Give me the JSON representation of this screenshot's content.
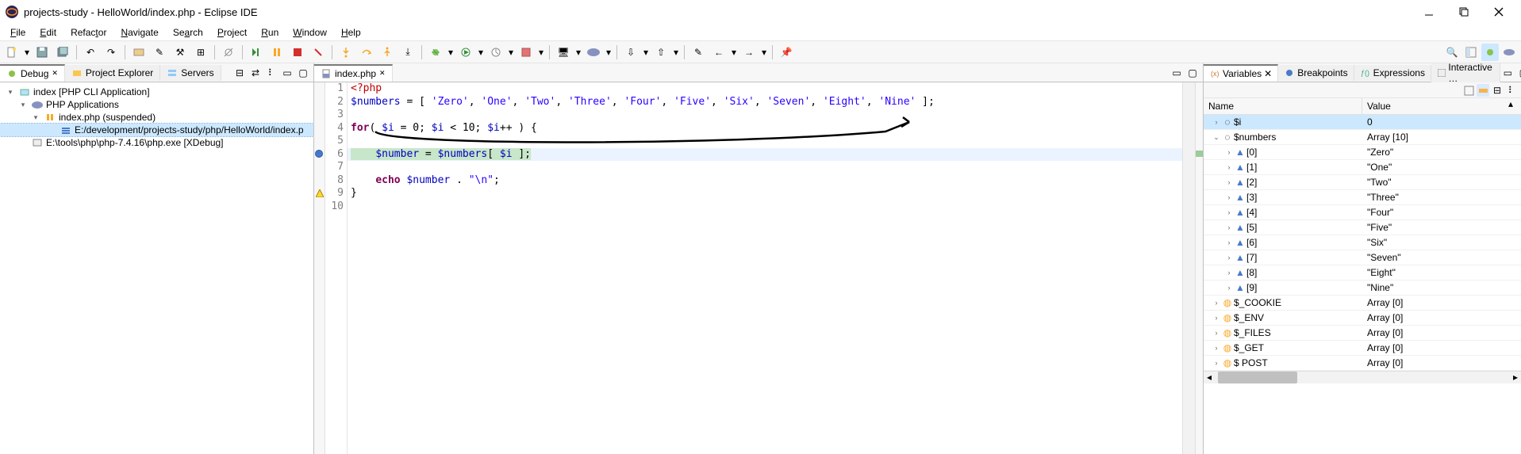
{
  "title": "projects-study - HelloWorld/index.php - Eclipse IDE",
  "menu": [
    "File",
    "Edit",
    "Refactor",
    "Navigate",
    "Search",
    "Project",
    "Run",
    "Window",
    "Help"
  ],
  "left_views": {
    "debug": "Debug",
    "project_explorer": "Project Explorer",
    "servers": "Servers"
  },
  "debug_tree": {
    "root": "index [PHP CLI Application]",
    "app": "PHP Applications",
    "thread": "index.php (suspended)",
    "frame": "E:/development/projects-study/php/HelloWorld/index.p",
    "exe": "E:\\tools\\php\\php-7.4.16\\php.exe [XDebug]"
  },
  "editor": {
    "tab": "index.php",
    "lines": [
      "1",
      "2",
      "3",
      "4",
      "5",
      "6",
      "7",
      "8",
      "9",
      "10"
    ],
    "code": {
      "l1_tag": "<?php",
      "l2_var": "$numbers",
      "l2_a": " = [ ",
      "l2_s0": "'Zero'",
      "l2_s1": "'One'",
      "l2_s2": "'Two'",
      "l2_s3": "'Three'",
      "l2_s4": "'Four'",
      "l2_s5": "'Five'",
      "l2_s6": "'Six'",
      "l2_s7": "'Seven'",
      "l2_s8": "'Eight'",
      "l2_s9": "'Nine'",
      "l2_b": " ];",
      "l4_kw": "for",
      "l4_a": "( ",
      "l4_v1": "$i",
      "l4_b": " = 0; ",
      "l4_v2": "$i",
      "l4_c": " < 10; ",
      "l4_v3": "$i",
      "l4_d": "++ ) {",
      "l6_pad": "    ",
      "l6_v1": "$number",
      "l6_a": " = ",
      "l6_v2": "$numbers",
      "l6_b": "[ ",
      "l6_v3": "$i",
      "l6_c": " ];",
      "l8_pad": "    ",
      "l8_kw": "echo",
      "l8_sp": " ",
      "l8_v": "$number",
      "l8_a": " . ",
      "l8_s": "\"\\n\"",
      "l8_b": ";",
      "l9": "}"
    }
  },
  "right_views": {
    "variables": "Variables",
    "breakpoints": "Breakpoints",
    "expressions": "Expressions",
    "interactive": "Interactive …"
  },
  "vars_header": {
    "name": "Name",
    "value": "Value"
  },
  "vars": {
    "i_name": "$i",
    "i_val": "0",
    "num_name": "$numbers",
    "num_val": "Array [10]",
    "idx": [
      "[0]",
      "[1]",
      "[2]",
      "[3]",
      "[4]",
      "[5]",
      "[6]",
      "[7]",
      "[8]",
      "[9]"
    ],
    "vals": [
      "\"Zero\"",
      "\"One\"",
      "\"Two\"",
      "\"Three\"",
      "\"Four\"",
      "\"Five\"",
      "\"Six\"",
      "\"Seven\"",
      "\"Eight\"",
      "\"Nine\""
    ],
    "cookie_n": "$_COOKIE",
    "cookie_v": "Array [0]",
    "env_n": "$_ENV",
    "env_v": "Array [0]",
    "files_n": "$_FILES",
    "files_v": "Array [0]",
    "get_n": "$_GET",
    "get_v": "Array [0]",
    "post_n": "$ POST",
    "post_v": "Array [0]"
  }
}
